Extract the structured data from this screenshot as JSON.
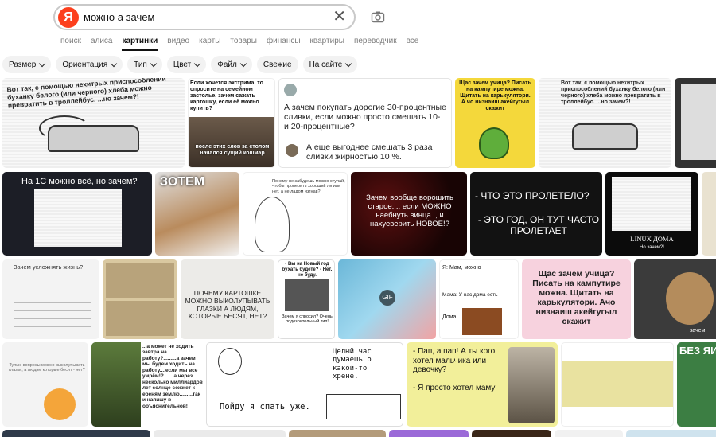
{
  "search": {
    "logo": "Я",
    "query": "можно а зачем"
  },
  "tabs": [
    {
      "label": "поиск"
    },
    {
      "label": "алиса"
    },
    {
      "label": "картинки",
      "active": true
    },
    {
      "label": "видео"
    },
    {
      "label": "карты"
    },
    {
      "label": "товары"
    },
    {
      "label": "финансы"
    },
    {
      "label": "квартиры"
    },
    {
      "label": "переводчик"
    },
    {
      "label": "все"
    }
  ],
  "filters": [
    {
      "label": "Размер",
      "dropdown": true
    },
    {
      "label": "Ориентация",
      "dropdown": true
    },
    {
      "label": "Тип",
      "dropdown": true
    },
    {
      "label": "Цвет",
      "dropdown": true
    },
    {
      "label": "Файл",
      "dropdown": true
    },
    {
      "label": "Свежие",
      "dropdown": false
    },
    {
      "label": "На сайте",
      "dropdown": true
    }
  ],
  "images": {
    "r1_1": "Вот так, с помощью нехитрых приспособлений буханку белого (или черного) хлеба можно превратить в троллейбус. ...но зачем?!",
    "r1_2_top": "Если хочется экстрима, то спросите на семейном застолье, зачем сажать картошку, если её можно купить?",
    "r1_2_bottom": "после этих слов за столом начался сущий кошмар",
    "r1_3_q": "А зачем покупать дорогие 30-процентные сливки, если можно просто смешать 10- и 20-процентные?",
    "r1_3_a": "А еще выгоднее смешать 3 раза сливки жирностью 10 %.",
    "r1_4": "Щас зачем учица? Писать на кампутире можна. Щитать на карькулятори. А чо низнаиш акейгугыл скажит",
    "r2_1": "На 1С можно всё, но зачем?",
    "r2_2": "ЗОТЕМ",
    "r2_3": "Почему не забудешь можно ступай, чтобы проверить хороший ли или нет, а не ладом изгнав?",
    "r2_4": "Зачем вообще ворошить старое..., если МОЖНО наебнуть винца.., и нахуеверить НОВОЕ!?",
    "r2_5a": "- ЧТО ЭТО ПРОЛЕТЕЛО?",
    "r2_5b": "- ЭТО ГОД, ОН ТУТ ЧАСТО ПРОЛЕТАЕТ",
    "r2_6a": "LINUX ДОМА",
    "r2_6b": "Но зачем?!",
    "r3_1": "Зачем усложнять жизнь?",
    "r3_3": "ПОЧЕМУ КАРТОШКЕ МОЖНО ВЫКОЛУПЫВАТЬ ГЛАЗКИ А ЛЮДЯМ, КОТОРЫЕ БЕСЯТ, НЕТ?",
    "r3_4a": "- Вы на Новый год бухать будете? - Нет, не буду.",
    "r3_4b": "Зачем я спросил? Очень подозрительный тип!",
    "r3_6a": "Я: Мам, можно",
    "r3_6b": "Мама: У нас дома есть",
    "r3_6c": "Дома:",
    "r3_7": "Щас зачем учица? Писать на кампутире можна. Щитать на карькулятори. Ачо низнаиш акейгугыл скажит",
    "r3_8": "зачем",
    "r4_1": "Тупые вопросы можно выколупывать глазки, а людям которые бесят - нет?",
    "r4_2": "...а может не ходить завтра на работу?.........а зачем мы будем ходить на работу....если мы все умрём!?.......а через несколько миллиардов лет солнце сожжет к ебеням землю.........так и напишу в объяснительной!",
    "r4_3a": "Целый час думаешь о какой-то хрене.",
    "r4_3b": "Пойду я спать уже.",
    "r4_4a": "- Пап, а пап! А ты кого хотел мальчика или девочку?",
    "r4_4b": "- Я просто хотел маму",
    "r4_6": "БЕЗ ЯИ"
  }
}
